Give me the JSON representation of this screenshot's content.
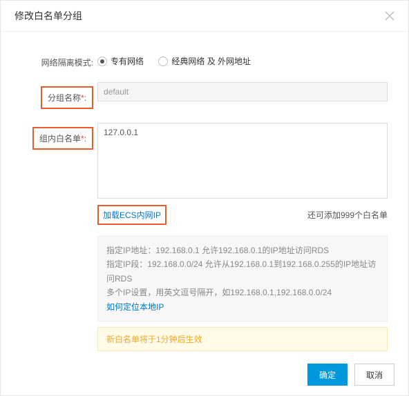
{
  "dialog": {
    "title": "修改白名单分组"
  },
  "labels": {
    "network_mode": "网络隔离模式:",
    "group_name": "分组名称",
    "whitelist": "组内白名单"
  },
  "radios": {
    "vpc": "专有网络",
    "classic": "经典网络 及 外网地址"
  },
  "fields": {
    "group_name_value": "default",
    "whitelist_value": "127.0.0.1"
  },
  "links": {
    "load_ecs_ip": "加载ECS内网IP",
    "locate_local_ip": "如何定位本地IP"
  },
  "hints": {
    "remaining": "还可添加999个白名单"
  },
  "info": {
    "line1": "指定IP地址：192.168.0.1 允许192.168.0.1的IP地址访问RDS",
    "line2": "指定IP段：192.168.0.0/24 允许从192.168.0.1到192.168.0.255的IP地址访问RDS",
    "line3": "多个IP设置，用英文逗号隔开，如192.168.0.1,192.168.0.0/24"
  },
  "notice": {
    "text": "新白名单将于1分钟后生效"
  },
  "buttons": {
    "confirm": "确定",
    "cancel": "取消"
  }
}
